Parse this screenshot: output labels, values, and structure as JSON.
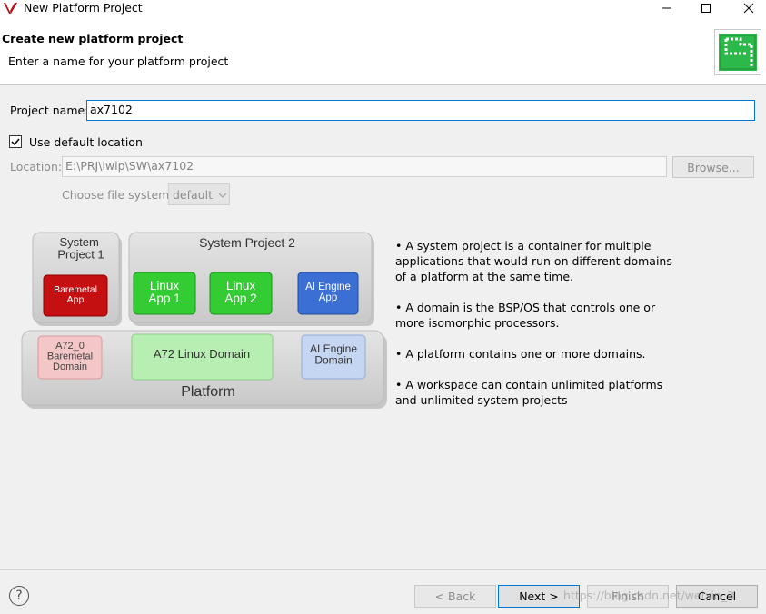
{
  "window": {
    "title": "New Platform Project",
    "controls": [
      "minimize-icon",
      "maximize-icon",
      "close-icon"
    ]
  },
  "header": {
    "title": "Create new platform project",
    "description": "Enter a name for your platform project",
    "icon": "platform-wizard-icon"
  },
  "form": {
    "project_name_label": "Project name:",
    "project_name_value": "ax7102",
    "use_default_label": "Use default location",
    "use_default_checked": true,
    "location_label": "Location:",
    "location_value": "E:\\PRJ\\lwip\\SW\\ax7102",
    "browse_label": "Browse...",
    "file_system_label": "Choose file system:",
    "file_system_value": "default"
  },
  "diagram": {
    "system_project_1": "System\nProject 1",
    "baremetal_app": "Baremetal\nApp",
    "system_project_2": "System Project 2",
    "linux_app_1": "Linux\nApp 1",
    "linux_app_2": "Linux\nApp 2",
    "ai_engine_app": "AI Engine\nApp",
    "a72_baremetal_domain": "A72_0\nBaremetal\nDomain",
    "a72_linux_domain": "A72 Linux Domain",
    "ai_engine_domain": "AI Engine\nDomain",
    "platform": "Platform"
  },
  "bullets": [
    "• A system project is a container for multiple applications that would run on different domains of a platform at the same time.",
    "• A domain is the BSP/OS that controls one or more isomorphic processors.",
    "• A platform contains one or more domains.",
    "• A workspace can contain unlimited platforms and unlimited system projects"
  ],
  "footer": {
    "help_icon": "help-icon",
    "help_glyph": "?",
    "back_label": "< Back",
    "next_label": "Next >",
    "finish_label": "Finish",
    "cancel_label": "Cancel",
    "watermark": "https://blog.csdn.net/weixin_3"
  },
  "colors": {
    "accent_border": "#0078d7",
    "baremetal_app": "#c41010",
    "linux_app": "#33cc33",
    "ai_engine_app": "#3b6fd4",
    "baremetal_domain": "#f3c7c7",
    "linux_domain": "#b7efb2",
    "ai_engine_domain": "#c5d6f2"
  }
}
